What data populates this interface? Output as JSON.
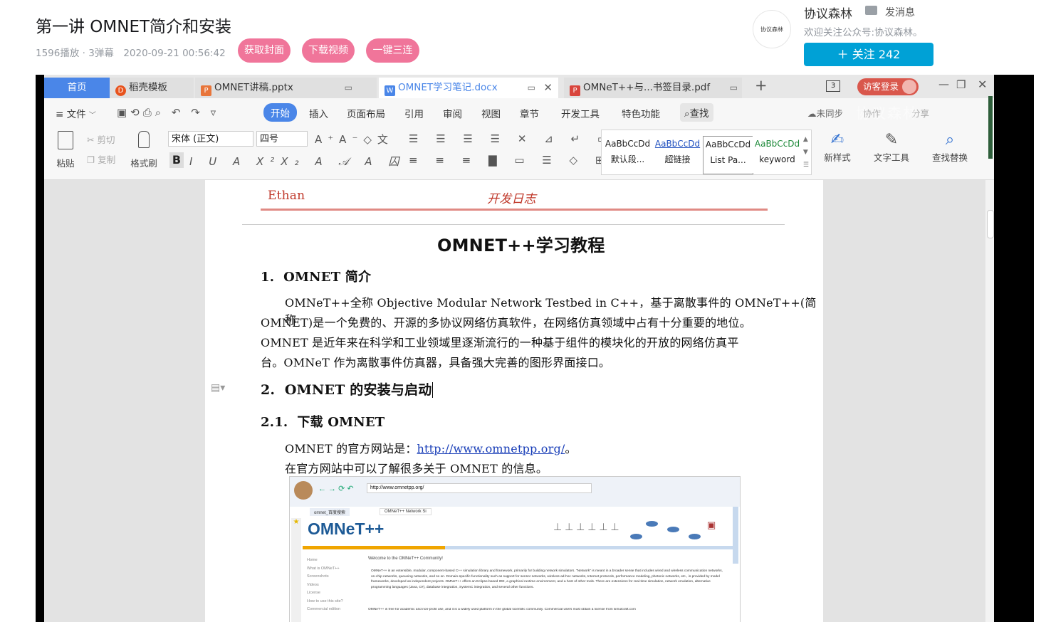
{
  "video": {
    "title": "第一讲 OMNET简介和安装",
    "meta": "1596播放 · 3弹幕　2020-09-21 00:56:42",
    "buttons": [
      "获取封面",
      "下载视频",
      "一键三连"
    ]
  },
  "uploader": {
    "avatar_text": "协议森林",
    "name": "协议森林",
    "message_label": "发消息",
    "sign": "欢迎关注公众号:协议森林。",
    "follow_label": "＋  关注 242"
  },
  "wps": {
    "tabs": [
      {
        "label": "首页"
      },
      {
        "label": "稻壳模板"
      },
      {
        "label": "OMNET讲稿.pptx"
      },
      {
        "label": "OMNET学习笔记.docx"
      },
      {
        "label": "OMNeT++与...书签目录.pdf"
      }
    ],
    "new_tab": "+",
    "tab_count": "3",
    "login_label": "访客登录",
    "menu": {
      "file": "≡ 文件",
      "items": [
        "开始",
        "插入",
        "页面布局",
        "引用",
        "审阅",
        "视图",
        "章节",
        "开发工具",
        "特色功能"
      ],
      "search": "查找",
      "right": [
        "未同步",
        "协作",
        "分享"
      ]
    },
    "ribbon": {
      "paste": "粘贴",
      "cut": "剪切",
      "copy": "复制",
      "format_painter": "格式刷",
      "font_name": "宋体 (正文)",
      "font_size": "四号",
      "styles": [
        {
          "sample": "AaBbCcDd",
          "name": "默认段..."
        },
        {
          "sample": "AaBbCcDd",
          "name": "超链接"
        },
        {
          "sample": "AaBbCcDd",
          "name": "List Pa..."
        },
        {
          "sample": "AaBbCcDd",
          "name": "keyword"
        }
      ],
      "new_style": "新样式",
      "text_tools": "文字工具",
      "find_replace": "查找替换"
    }
  },
  "document": {
    "header_left": "Ethan",
    "header_center": "开发日志",
    "title": "OMNET++学习教程",
    "h1_num": "1.",
    "h1_text": "OMNET 简介",
    "para1": [
      "OMNeT++全称 Objective Modular Network Testbed in C++，基于离散事件的 OMNeT++(简称",
      "OMNET)是一个免费的、开源的多协议网络仿真软件，在网络仿真领域中占有十分重要的地位。",
      "OMNET 是近年来在科学和工业领域里逐渐流行的一种基于组件的模块化的开放的网络仿真平",
      "台。OMNeT 作为离散事件仿真器，具备强大完善的图形界面接口。"
    ],
    "h2_num": "2.",
    "h2_text": "OMNET 的安装与启动",
    "h21_num": "2.1.",
    "h21_text": "下载 OMNET",
    "site_prefix": "OMNET 的官方网站是：",
    "site_url": "http://www.omnetpp.org/",
    "site_suffix": "。",
    "site_note": "在官方网站中可以了解很多关于 OMNET 的信息。"
  },
  "screenshot": {
    "url": "http://www.omnetpp.org/",
    "tabs": [
      "omnet_百度搜索",
      "OMNeT++ Network Si"
    ],
    "logo": "OMNeT++",
    "welcome": "Welcome to the OMNeT++ Community!",
    "nav": [
      "Home",
      "What is OMNeT++",
      "Screenshots",
      "Videos",
      "License",
      "How to use this site?",
      "Commercial edition"
    ],
    "para": "OMNeT++ is an extensible, modular, component-based C++ simulation library and framework, primarily for building network simulators. \"Network\" is meant in a broader sense that includes wired and wireless communication networks, on-chip networks, queueing networks, and so on. Domain-specific functionality such as support for sensor networks, wireless ad-hoc networks, Internet protocols, performance modeling, photonic networks, etc., is provided by model frameworks, developed as independent projects. OMNeT++ offers an Eclipse-based IDE, a graphical runtime environment, and a host of other tools. There are extensions for real-time simulation, network emulation, alternative programming languages (Java, C#), database integration, SystemC integration, and several other functions.",
    "para2": "OMNeT++ is free for academic and non-profit use, and it is a widely used platform in the global scientific community. Commercial users must obtain a license from simulcraft.com"
  },
  "watermark": "协议森林",
  "colors": {
    "pink": "#f0759a",
    "blue": "#00a1d6",
    "wps_blue": "#4a86e8",
    "header_red": "#c0392b"
  }
}
